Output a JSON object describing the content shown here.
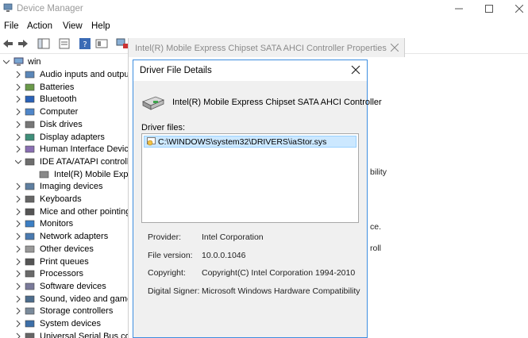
{
  "window": {
    "title": "Device Manager"
  },
  "menu": [
    "File",
    "Action",
    "View",
    "Help"
  ],
  "tree": {
    "root": "win",
    "items": [
      {
        "label": "Audio inputs and outputs",
        "expanded": false,
        "icon": "speaker-icon"
      },
      {
        "label": "Batteries",
        "expanded": false,
        "icon": "battery-icon"
      },
      {
        "label": "Bluetooth",
        "expanded": false,
        "icon": "bluetooth-icon"
      },
      {
        "label": "Computer",
        "expanded": false,
        "icon": "computer-icon"
      },
      {
        "label": "Disk drives",
        "expanded": false,
        "icon": "disk-drive-icon"
      },
      {
        "label": "Display adapters",
        "expanded": false,
        "icon": "display-adapter-icon"
      },
      {
        "label": "Human Interface Devices",
        "expanded": false,
        "icon": "hid-icon"
      },
      {
        "label": "IDE ATA/ATAPI controllers",
        "expanded": true,
        "icon": "ide-controller-icon"
      },
      {
        "label": "Intel(R) Mobile Express Chipset SATA AHCI Controller",
        "child": true,
        "icon": "controller-device-icon"
      },
      {
        "label": "Imaging devices",
        "expanded": false,
        "icon": "camera-icon"
      },
      {
        "label": "Keyboards",
        "expanded": false,
        "icon": "keyboard-icon"
      },
      {
        "label": "Mice and other pointing devices",
        "expanded": false,
        "icon": "mouse-icon"
      },
      {
        "label": "Monitors",
        "expanded": false,
        "icon": "monitor-icon"
      },
      {
        "label": "Network adapters",
        "expanded": false,
        "icon": "network-adapter-icon"
      },
      {
        "label": "Other devices",
        "expanded": false,
        "icon": "unknown-device-icon"
      },
      {
        "label": "Print queues",
        "expanded": false,
        "icon": "printer-icon"
      },
      {
        "label": "Processors",
        "expanded": false,
        "icon": "processor-icon"
      },
      {
        "label": "Software devices",
        "expanded": false,
        "icon": "software-device-icon"
      },
      {
        "label": "Sound, video and game controllers",
        "expanded": false,
        "icon": "sound-icon"
      },
      {
        "label": "Storage controllers",
        "expanded": false,
        "icon": "storage-controller-icon"
      },
      {
        "label": "System devices",
        "expanded": false,
        "icon": "system-device-icon"
      },
      {
        "label": "Universal Serial Bus controllers",
        "expanded": false,
        "icon": "usb-icon"
      }
    ]
  },
  "properties_dialog": {
    "title": "Intel(R) Mobile Express Chipset SATA AHCI Controller Properties",
    "fragments": [
      "bility",
      "ce.",
      "roll"
    ]
  },
  "driver_details": {
    "title": "Driver File Details",
    "device_name": "Intel(R) Mobile Express Chipset SATA AHCI Controller",
    "driver_files_label": "Driver files:",
    "files": [
      "C:\\WINDOWS\\system32\\DRIVERS\\iaStor.sys"
    ],
    "info": [
      {
        "key": "Provider:",
        "value": "Intel Corporation"
      },
      {
        "key": "File version:",
        "value": "10.0.0.1046"
      },
      {
        "key": "Copyright:",
        "value": "Copyright(C) Intel Corporation 1994-2010"
      },
      {
        "key": "Digital Signer:",
        "value": "Microsoft Windows Hardware Compatibility"
      }
    ]
  },
  "colors": {
    "accent_border": "#3d8ee0",
    "selection": "#cce8ff"
  }
}
